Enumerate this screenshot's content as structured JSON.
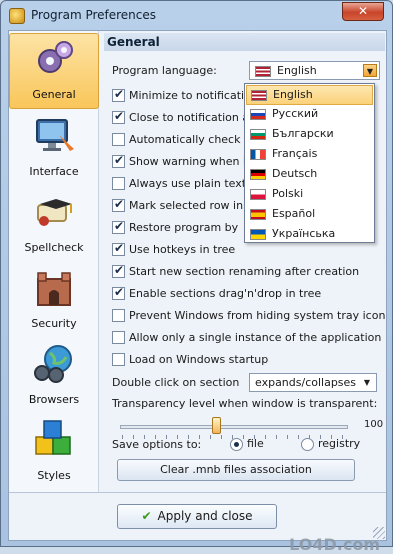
{
  "window": {
    "title": "Program Preferences",
    "close_label": "✕"
  },
  "sidebar": {
    "items": [
      {
        "label": "General",
        "icon": "gear-icon",
        "selected": true
      },
      {
        "label": "Interface",
        "icon": "monitor-icon",
        "selected": false
      },
      {
        "label": "Spellcheck",
        "icon": "diploma-icon",
        "selected": false
      },
      {
        "label": "Security",
        "icon": "castle-icon",
        "selected": false
      },
      {
        "label": "Browsers",
        "icon": "binoculars-globe-icon",
        "selected": false
      },
      {
        "label": "Styles",
        "icon": "cubes-icon",
        "selected": false
      }
    ]
  },
  "panel": {
    "title": "General",
    "language_label": "Program language:",
    "language_value": "English",
    "language_options": [
      "English",
      "Русский",
      "Български",
      "Français",
      "Deutsch",
      "Polski",
      "Español",
      "Українська"
    ],
    "options": [
      {
        "label": "Minimize to notification a",
        "checked": true
      },
      {
        "label": "Close to notification area",
        "checked": true
      },
      {
        "label": "Automatically check for n",
        "checked": false
      },
      {
        "label": "Show warning when I do",
        "checked": true
      },
      {
        "label": "Always use plain text pa",
        "checked": false
      },
      {
        "label": "Mark selected row in tre",
        "checked": true
      },
      {
        "label": "Restore program by",
        "checked": true
      },
      {
        "label": "Use hotkeys in tree",
        "checked": true
      },
      {
        "label": "Start new section renaming after creation",
        "checked": true
      },
      {
        "label": "Enable sections drag'n'drop in tree",
        "checked": true
      },
      {
        "label": "Prevent Windows from hiding system tray icon",
        "checked": false
      },
      {
        "label": "Allow only a single instance of the application",
        "checked": false
      },
      {
        "label": "Load on Windows startup",
        "checked": false
      }
    ],
    "double_click_label": "Double click on section",
    "double_click_value": "expands/collapses",
    "transparency_label": "Transparency level when window is transparent:",
    "transparency_value": "100",
    "transparency_level": 0.42,
    "save_label": "Save options to:",
    "save_file": "file",
    "save_registry": "registry",
    "save_selected": "file",
    "clear_button": "Clear .mnb files association"
  },
  "footer": {
    "apply_label": "Apply and close",
    "apply_icon": "checkmark-icon"
  },
  "watermark": "LO4D.com",
  "colors": {
    "selected_bg": "#f9c65a",
    "accent": "#3b9a1e"
  }
}
